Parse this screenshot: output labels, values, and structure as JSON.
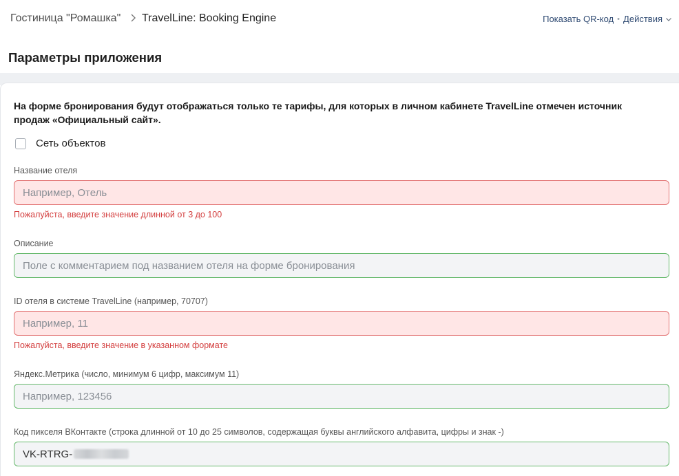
{
  "breadcrumb": {
    "home": "Гостиница \"Ромашка\"",
    "current": "TravelLine: Booking Engine"
  },
  "top_actions": {
    "qr": "Показать QR-код",
    "actions": "Действия"
  },
  "page_title": "Параметры приложения",
  "notice": "На форме бронирования будут отображаться только те тарифы, для которых в личном кабинете TravelLine отмечен источник продаж «Официальный сайт».",
  "network_checkbox": {
    "label": "Сеть объектов"
  },
  "fields": {
    "hotel_name": {
      "label": "Название отеля",
      "placeholder": "Например, Отель",
      "error": "Пожалуйста, введите значение длинной от 3 до 100"
    },
    "description": {
      "label": "Описание",
      "placeholder": "Поле с комментарием под названием отеля на форме бронирования"
    },
    "hotel_id": {
      "label": "ID отеля в системе TravelLine (например, 70707)",
      "placeholder": "Например, 11",
      "error": "Пожалуйста, введите значение в указанном формате"
    },
    "metrika": {
      "label": "Яндекс.Метрика (число, минимум 6 цифр, максимум 11)",
      "placeholder": "Например, 123456"
    },
    "vk_pixel": {
      "label": "Код пикселя ВКонтакте (строка длинной от 10 до 25 символов, содержащая буквы английского алфавита, цифры и знак -)",
      "value_prefix": "VK-RTRG-"
    }
  },
  "colors": {
    "error_bg": "#ffe6e6",
    "error_border": "#e27272",
    "error_text": "#d33d3d",
    "ok_border": "#65b96b",
    "link": "#2f4a72"
  }
}
